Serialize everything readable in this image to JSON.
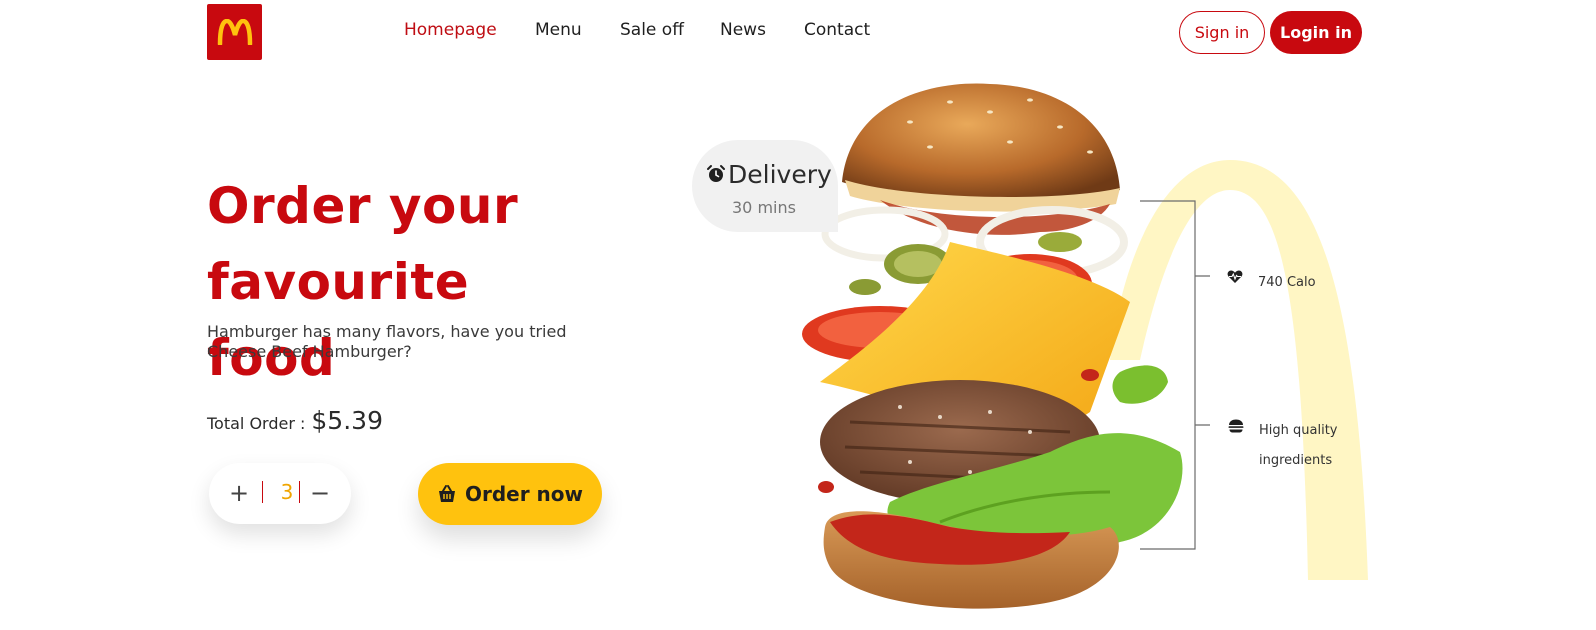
{
  "brand": {
    "logo_glyph": "m",
    "color": "#c8090f"
  },
  "nav": {
    "items": [
      {
        "label": "Homepage",
        "active": true
      },
      {
        "label": "Menu",
        "active": false
      },
      {
        "label": "Sale off",
        "active": false
      },
      {
        "label": "News",
        "active": false
      },
      {
        "label": "Contact",
        "active": false
      }
    ]
  },
  "auth": {
    "signin_label": "Sign in",
    "login_label": "Login in"
  },
  "hero": {
    "title_line1": "Order your favourite",
    "title_line2": "food",
    "subtitle": "Hamburger has many flavors, have you tried Cheese Beef Hamburger?",
    "total_label": "Total Order :",
    "total_value": "$5.39",
    "quantity": "3",
    "plus_glyph": "+",
    "minus_glyph": "−",
    "order_label": "Order now"
  },
  "delivery": {
    "title": "Delivery",
    "time": "30 mins"
  },
  "features": [
    {
      "icon": "heart-pulse-icon",
      "label": "740 Calo"
    },
    {
      "icon": "burger-icon",
      "label_line1": "High quality",
      "label_line2": "ingredients"
    }
  ],
  "colors": {
    "primary": "#c8090f",
    "accent": "#ffc20e",
    "arch": "#fff6c4"
  }
}
